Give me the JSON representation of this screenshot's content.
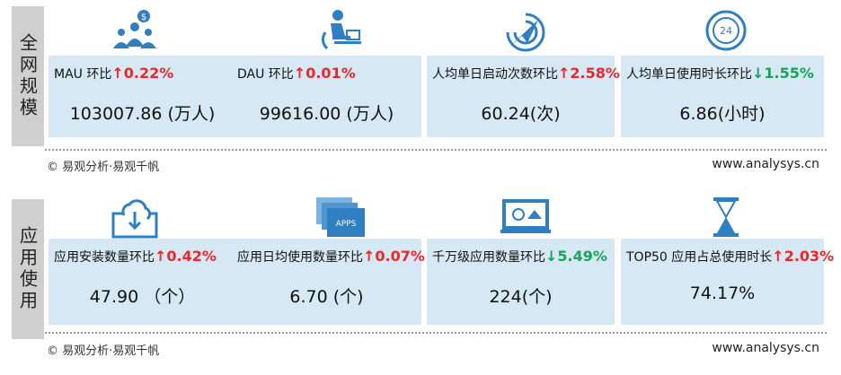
{
  "section1": {
    "side_label": "全网规模",
    "cards": [
      {
        "label": "MAU 环比",
        "arrow": "↑",
        "pct": "0.22%",
        "dir": "up",
        "value": "103007.86 (万人)",
        "icon": "people-money-icon"
      },
      {
        "label": "DAU 环比",
        "arrow": "↑",
        "pct": "0.01%",
        "dir": "up",
        "value": "99616.00 (万人)",
        "icon": "person-laptop-icon"
      },
      {
        "label": "人均单日启动次数环比",
        "arrow": "↑",
        "pct": "2.58%",
        "dir": "up",
        "value": "60.24(次)",
        "icon": "launch-target-icon"
      },
      {
        "label": "人均单日使用时长环比",
        "arrow": "↓",
        "pct": "1.55%",
        "dir": "down",
        "value": "6.86(小时)",
        "icon": "clock-24-icon"
      }
    ],
    "footer_left": "©  易观分析·易观千帆",
    "footer_right": "www.analysys.cn"
  },
  "section2": {
    "side_label": "应用使用",
    "cards": [
      {
        "label": "应用安装数量环比",
        "arrow": "↑",
        "pct": "0.42%",
        "dir": "up",
        "value": "47.90 （个）",
        "icon": "cloud-download-icon"
      },
      {
        "label": "应用日均使用数量环比",
        "arrow": "↑",
        "pct": "0.07%",
        "dir": "up",
        "value": "6.70 (个)",
        "icon": "apps-stack-icon"
      },
      {
        "label": "千万级应用数量环比",
        "arrow": "↓",
        "pct": "5.49%",
        "dir": "down",
        "value": "224(个)",
        "icon": "monitor-home-icon"
      },
      {
        "label": "TOP50 应用占总使用时长",
        "arrow": "↑",
        "pct": "2.03%",
        "dir": "up",
        "value": "74.17%",
        "icon": "hourglass-icon"
      }
    ],
    "footer_left": "©  易观分析·易观千帆",
    "footer_right": "www.analysys.cn",
    "apps_text": "APPS"
  },
  "colors": {
    "card_bg": "#d6e8f3",
    "up": "#e8282b",
    "down": "#1aa25a",
    "icon_blue": "#2f7fc1",
    "side_bg": "#cfcfcf"
  }
}
